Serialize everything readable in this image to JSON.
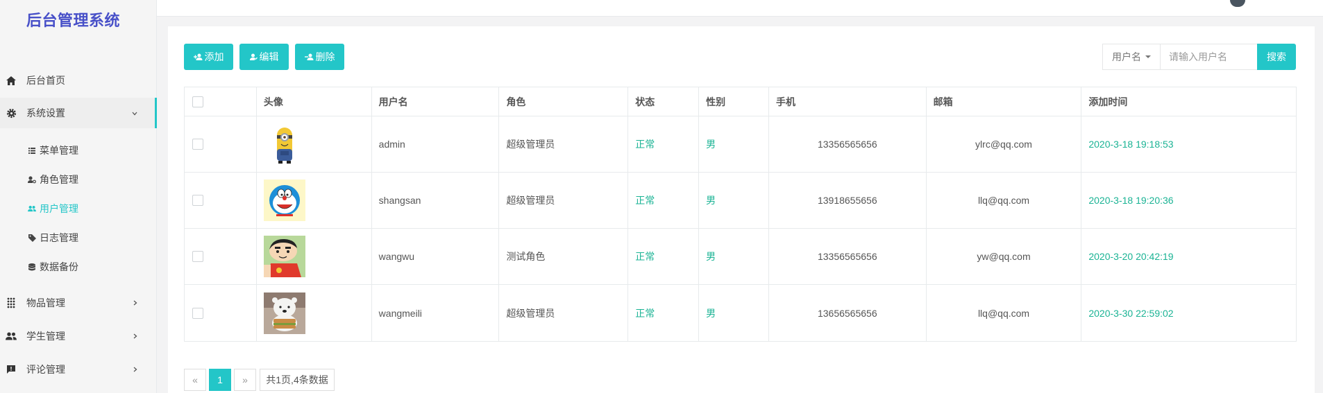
{
  "app": {
    "title": "后台管理系统"
  },
  "sidebar": {
    "items": [
      {
        "label": "后台首页",
        "icon": "home-icon"
      },
      {
        "label": "系统设置",
        "icon": "gear-icon",
        "expanded": true,
        "children": [
          {
            "label": "菜单管理",
            "icon": "list-icon"
          },
          {
            "label": "角色管理",
            "icon": "user-key-icon"
          },
          {
            "label": "用户管理",
            "icon": "users-icon",
            "current": true
          },
          {
            "label": "日志管理",
            "icon": "tag-icon"
          },
          {
            "label": "数据备份",
            "icon": "database-icon"
          }
        ]
      },
      {
        "label": "物品管理",
        "icon": "grid-dots-icon"
      },
      {
        "label": "学生管理",
        "icon": "users-icon"
      },
      {
        "label": "评论管理",
        "icon": "comment-icon"
      }
    ]
  },
  "toolbar": {
    "add_label": "添加",
    "edit_label": "编辑",
    "delete_label": "删除"
  },
  "search": {
    "field_label": "用户名",
    "placeholder": "请输入用户名",
    "button_label": "搜索"
  },
  "table": {
    "columns": [
      "头像",
      "用户名",
      "角色",
      "状态",
      "性别",
      "手机",
      "邮箱",
      "添加时间"
    ],
    "rows": [
      {
        "avatar": "minion",
        "username": "admin",
        "role": "超级管理员",
        "status": "正常",
        "gender": "男",
        "phone": "13356565656",
        "email": "ylrc@qq.com",
        "created": "2020-3-18 19:18:53"
      },
      {
        "avatar": "doraemon",
        "username": "shangsan",
        "role": "超级管理员",
        "status": "正常",
        "gender": "男",
        "phone": "13918655656",
        "email": "llq@qq.com",
        "created": "2020-3-18 19:20:36"
      },
      {
        "avatar": "crayon-shin",
        "username": "wangwu",
        "role": "测试角色",
        "status": "正常",
        "gender": "男",
        "phone": "13356565656",
        "email": "yw@qq.com",
        "created": "2020-3-20 20:42:19"
      },
      {
        "avatar": "ice-bear",
        "username": "wangmeili",
        "role": "超级管理员",
        "status": "正常",
        "gender": "男",
        "phone": "13656565656",
        "email": "llq@qq.com",
        "created": "2020-3-30 22:59:02"
      }
    ]
  },
  "pagination": {
    "prev": "«",
    "current": "1",
    "next": "»",
    "info": "共1页,4条数据"
  },
  "colors": {
    "accent": "#23c6c8",
    "green": "#1ab394",
    "brand": "#4850c8"
  }
}
